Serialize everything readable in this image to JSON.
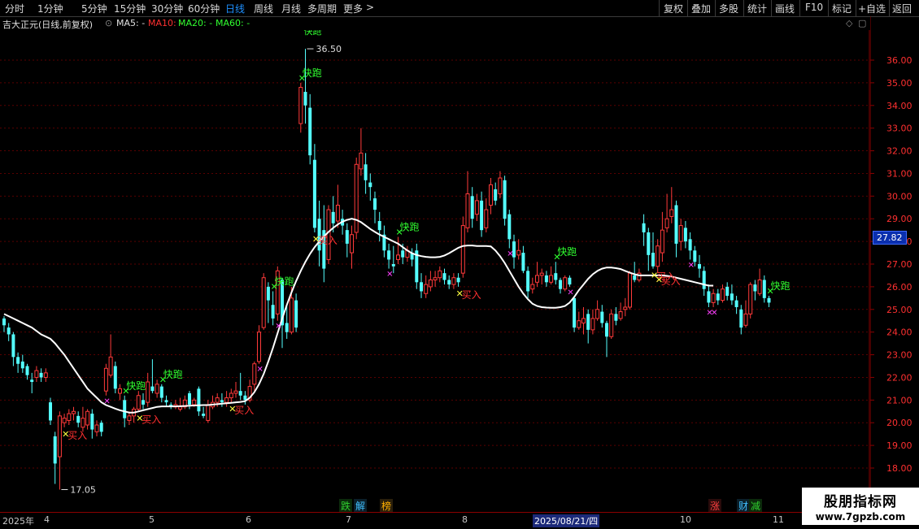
{
  "toolbar": {
    "periods": [
      "分时",
      "1分钟",
      "5分钟",
      "15分钟",
      "30分钟",
      "60分钟",
      "日线",
      "周线",
      "月线",
      "多周期",
      "更多"
    ],
    "more_arrow": ">",
    "active_period": "日线",
    "tools": [
      "复权",
      "叠加",
      "多股",
      "统计",
      "画线",
      "F10",
      "标记",
      "+自选",
      "返回"
    ]
  },
  "chart_title": {
    "name": "吉大正元(日线,前复权)",
    "ma5": "MA5: -",
    "ma10": "MA10: -",
    "ma20": "MA20: -",
    "ma60": "MA60: -",
    "colors": {
      "name": "#e0e0e0",
      "ma5": "#e0e0e0",
      "ma10": "#ff3030",
      "ma20": "#30ff30",
      "ma60": "#30ff30"
    }
  },
  "price_tag": "27.82",
  "annotations": {
    "high": "36.50",
    "low": "17.05",
    "high_mark": "快跑"
  },
  "events": [
    {
      "label": "跌",
      "color": "#30d030",
      "bg": "#0b2a0b"
    },
    {
      "label": "解",
      "color": "#40c0ff",
      "bg": "#0b1f2a"
    },
    {
      "label": "榜",
      "color": "#ffb000",
      "bg": "#2a1f0b"
    },
    {
      "label": "涨",
      "color": "#ff4040",
      "bg": "#2a0b0b"
    },
    {
      "label": "财",
      "color": "#40c0ff",
      "bg": "#0b1f2a"
    },
    {
      "label": "减",
      "color": "#30d030",
      "bg": "#0b2a0b"
    }
  ],
  "dates": [
    {
      "label": "2025年",
      "hl": false
    },
    {
      "label": "4",
      "hl": false
    },
    {
      "label": "5",
      "hl": false
    },
    {
      "label": "6",
      "hl": false
    },
    {
      "label": "7",
      "hl": false
    },
    {
      "label": "8",
      "hl": false
    },
    {
      "label": "2025/08/21/四",
      "hl": true
    },
    {
      "label": "10",
      "hl": false
    },
    {
      "label": "11",
      "hl": false
    }
  ],
  "watermark": {
    "line1": "股朋指标网",
    "line2": "www.7gpzb.com"
  },
  "chart_data": {
    "type": "candlestick",
    "title": "吉大正元(日线,前复权)",
    "ylim": [
      17.4,
      36.8
    ],
    "yticks": [
      18,
      19,
      20,
      21,
      22,
      23,
      24,
      25,
      26,
      27,
      28,
      29,
      30,
      31,
      32,
      33,
      34,
      35,
      36
    ],
    "ytick_labels": [
      "18.00",
      "19.00",
      "20.00",
      "21.00",
      "22.00",
      "23.00",
      "24.00",
      "25.00",
      "26.00",
      "27.00",
      "28.00",
      "29.00",
      "30.00",
      "31.00",
      "32.00",
      "33.00",
      "34.00",
      "35.00",
      "36.00"
    ],
    "grid": true,
    "up_color": "#ff3a3a",
    "down_color": "#54ffff",
    "ma_color": "#ffffff",
    "signal_colors": {
      "sell": "#30ff30",
      "buy": "#ffff40",
      "buy_text": "#ff3030",
      "x_mark": "#ff40ff"
    },
    "signal_labels": {
      "sell": "快跑",
      "buy": "买入"
    },
    "candles": [
      [
        24.6,
        24.3,
        24.7,
        24.0
      ],
      [
        24.2,
        23.9,
        24.4,
        23.6
      ],
      [
        23.9,
        22.9,
        24.0,
        22.5
      ],
      [
        22.9,
        22.6,
        23.1,
        22.2
      ],
      [
        22.7,
        22.4,
        23.0,
        22.2
      ],
      [
        22.5,
        22.1,
        22.6,
        21.9
      ],
      [
        21.9,
        21.8,
        22.2,
        21.3
      ],
      [
        22.0,
        22.3,
        22.5,
        21.8
      ],
      [
        22.2,
        22.0,
        22.4,
        21.8
      ],
      [
        22.0,
        22.2,
        22.4,
        21.8
      ],
      [
        20.9,
        20.1,
        21.1,
        19.9
      ],
      [
        19.4,
        18.2,
        19.6,
        17.3
      ],
      [
        18.5,
        20.3,
        20.5,
        17.05
      ],
      [
        20.0,
        20.2,
        20.4,
        19.8
      ],
      [
        20.1,
        20.4,
        20.6,
        19.9
      ],
      [
        20.4,
        20.5,
        20.7,
        20.1
      ],
      [
        20.3,
        20.0,
        20.5,
        19.8
      ],
      [
        19.8,
        20.2,
        20.7,
        19.6
      ],
      [
        19.9,
        20.5,
        20.6,
        19.7
      ],
      [
        20.4,
        19.7,
        20.6,
        19.3
      ],
      [
        19.6,
        19.9,
        20.1,
        19.4
      ],
      [
        20.0,
        19.6,
        20.1,
        19.4
      ],
      [
        21.4,
        22.4,
        22.6,
        21.2
      ],
      [
        22.1,
        22.9,
        23.9,
        22.0
      ],
      [
        22.5,
        21.5,
        22.7,
        21.3
      ],
      [
        21.3,
        21.5,
        21.7,
        21.0
      ],
      [
        21.0,
        20.2,
        21.2,
        19.8
      ],
      [
        20.1,
        20.3,
        20.5,
        19.9
      ],
      [
        20.3,
        20.6,
        20.7,
        20.0
      ],
      [
        20.6,
        21.2,
        21.4,
        20.5
      ],
      [
        21.0,
        20.8,
        21.3,
        20.6
      ],
      [
        20.9,
        21.8,
        22.2,
        20.7
      ],
      [
        21.6,
        21.4,
        22.8,
        21.3
      ],
      [
        21.3,
        21.7,
        21.9,
        21.1
      ],
      [
        21.6,
        21.1,
        21.7,
        20.9
      ],
      [
        21.0,
        20.9,
        21.2,
        20.7
      ],
      [
        20.8,
        20.7,
        20.9,
        20.6
      ],
      [
        20.7,
        20.8,
        21.0,
        20.6
      ],
      [
        20.6,
        20.7,
        21.1,
        20.5
      ],
      [
        20.7,
        21.0,
        21.2,
        20.6
      ],
      [
        21.3,
        20.8,
        21.4,
        20.6
      ],
      [
        20.8,
        21.0,
        21.1,
        20.7
      ],
      [
        21.5,
        20.5,
        21.6,
        20.3
      ],
      [
        20.4,
        20.3,
        20.7,
        20.2
      ],
      [
        20.1,
        20.8,
        21.0,
        20.0
      ],
      [
        20.7,
        20.9,
        21.2,
        20.6
      ],
      [
        20.9,
        21.1,
        21.3,
        20.7
      ],
      [
        21.0,
        20.9,
        21.3,
        20.7
      ],
      [
        20.9,
        21.1,
        21.4,
        20.7
      ],
      [
        21.1,
        21.3,
        21.5,
        20.9
      ],
      [
        21.3,
        21.4,
        21.8,
        21.1
      ],
      [
        21.4,
        21.2,
        22.2,
        21.0
      ],
      [
        21.2,
        21.0,
        21.4,
        20.8
      ],
      [
        21.0,
        21.6,
        21.9,
        20.9
      ],
      [
        21.7,
        22.6,
        22.7,
        21.4
      ],
      [
        22.7,
        24.0,
        24.3,
        22.6
      ],
      [
        24.2,
        26.4,
        26.6,
        24.1
      ],
      [
        26.0,
        25.4,
        26.2,
        24.4
      ],
      [
        25.2,
        24.6,
        25.8,
        24.3
      ],
      [
        24.8,
        26.7,
        26.9,
        24.5
      ],
      [
        26.3,
        24.3,
        26.4,
        23.3
      ],
      [
        24.4,
        24.0,
        25.2,
        23.7
      ],
      [
        24.0,
        25.5,
        26.0,
        23.9
      ],
      [
        25.4,
        24.2,
        25.7,
        24.0
      ],
      [
        33.2,
        34.8,
        35.0,
        32.8
      ],
      [
        34.6,
        34.0,
        36.5,
        33.2
      ],
      [
        33.9,
        31.8,
        34.5,
        31.4
      ],
      [
        31.6,
        28.6,
        32.3,
        28.4
      ],
      [
        29.0,
        27.6,
        29.8,
        26.9
      ],
      [
        28.5,
        26.8,
        29.6,
        26.2
      ],
      [
        27.2,
        29.4,
        29.6,
        27.0
      ],
      [
        29.3,
        28.8,
        30.0,
        28.4
      ],
      [
        28.9,
        29.6,
        30.5,
        28.6
      ],
      [
        29.0,
        28.7,
        29.4,
        28.3
      ],
      [
        28.5,
        27.9,
        28.8,
        27.3
      ],
      [
        27.5,
        28.3,
        28.7,
        26.8
      ],
      [
        28.4,
        31.4,
        31.7,
        28.1
      ],
      [
        31.2,
        31.9,
        33.0,
        30.9
      ],
      [
        31.4,
        30.7,
        31.9,
        30.1
      ],
      [
        30.6,
        30.4,
        31.0,
        29.8
      ],
      [
        29.9,
        29.4,
        30.2,
        28.8
      ],
      [
        28.9,
        28.5,
        29.3,
        28.0
      ],
      [
        28.3,
        27.6,
        28.7,
        27.3
      ],
      [
        27.6,
        27.2,
        27.9,
        26.8
      ],
      [
        27.0,
        26.9,
        27.8,
        26.6
      ],
      [
        27.2,
        27.4,
        28.2,
        27.0
      ],
      [
        27.6,
        27.3,
        27.9,
        27.0
      ],
      [
        27.3,
        27.6,
        27.8,
        27.1
      ],
      [
        27.5,
        27.2,
        27.7,
        26.9
      ],
      [
        27.6,
        26.2,
        27.9,
        25.9
      ],
      [
        26.2,
        25.8,
        26.6,
        25.5
      ],
      [
        25.7,
        26.1,
        26.5,
        25.5
      ],
      [
        26.0,
        26.3,
        26.7,
        25.8
      ],
      [
        26.3,
        26.4,
        26.7,
        26.0
      ],
      [
        26.4,
        26.7,
        26.9,
        26.2
      ],
      [
        26.6,
        26.3,
        26.8,
        26.1
      ],
      [
        26.3,
        26.1,
        26.5,
        25.9
      ],
      [
        26.1,
        26.4,
        26.6,
        25.9
      ],
      [
        26.4,
        26.2,
        26.6,
        26.0
      ],
      [
        26.6,
        28.7,
        29.1,
        26.4
      ],
      [
        28.6,
        30.1,
        31.1,
        28.4
      ],
      [
        30.0,
        29.0,
        30.4,
        28.6
      ],
      [
        29.2,
        29.8,
        30.1,
        28.9
      ],
      [
        29.8,
        28.5,
        30.2,
        28.2
      ],
      [
        28.6,
        29.4,
        29.9,
        28.4
      ],
      [
        29.6,
        30.5,
        30.8,
        29.2
      ],
      [
        30.3,
        29.8,
        30.6,
        29.6
      ],
      [
        30.1,
        30.8,
        31.1,
        29.9
      ],
      [
        30.7,
        29.0,
        30.9,
        28.7
      ],
      [
        29.2,
        28.1,
        29.4,
        27.7
      ],
      [
        28.0,
        27.3,
        28.3,
        26.8
      ],
      [
        27.4,
        27.6,
        28.1,
        27.2
      ],
      [
        27.5,
        26.7,
        27.8,
        26.6
      ],
      [
        26.7,
        25.8,
        26.9,
        25.5
      ],
      [
        25.9,
        26.1,
        26.4,
        25.7
      ],
      [
        26.2,
        26.5,
        27.1,
        26.0
      ],
      [
        26.5,
        26.6,
        26.8,
        26.1
      ],
      [
        26.5,
        26.2,
        26.7,
        26.0
      ],
      [
        26.2,
        26.5,
        26.9,
        26.1
      ],
      [
        26.6,
        26.3,
        27.1,
        26.1
      ],
      [
        26.3,
        25.9,
        26.4,
        25.7
      ],
      [
        25.9,
        26.4,
        26.5,
        25.8
      ],
      [
        26.4,
        26.1,
        26.5,
        26.0
      ],
      [
        25.5,
        24.2,
        25.6,
        24.0
      ],
      [
        24.2,
        24.5,
        24.9,
        24.1
      ],
      [
        24.4,
        24.6,
        25.1,
        23.9
      ],
      [
        24.8,
        24.1,
        25.0,
        23.5
      ],
      [
        24.1,
        24.6,
        25.0,
        23.9
      ],
      [
        24.6,
        25.0,
        25.4,
        24.5
      ],
      [
        24.9,
        24.4,
        25.2,
        24.2
      ],
      [
        24.4,
        23.8,
        24.5,
        22.9
      ],
      [
        23.8,
        24.8,
        25.0,
        23.7
      ],
      [
        24.8,
        24.5,
        25.1,
        24.3
      ],
      [
        24.6,
        24.9,
        25.3,
        24.5
      ],
      [
        25.0,
        25.1,
        25.5,
        24.7
      ],
      [
        25.1,
        26.6,
        26.7,
        25.0
      ],
      [
        26.5,
        26.3,
        27.1,
        26.2
      ],
      [
        26.3,
        26.6,
        26.8,
        26.2
      ],
      [
        28.8,
        28.4,
        29.2,
        27.8
      ],
      [
        28.4,
        27.4,
        28.6,
        26.7
      ],
      [
        27.5,
        26.9,
        28.4,
        26.8
      ],
      [
        26.9,
        27.8,
        28.1,
        26.6
      ],
      [
        27.5,
        28.5,
        29.3,
        27.1
      ],
      [
        28.6,
        29.0,
        30.1,
        28.4
      ],
      [
        29.1,
        29.4,
        30.4,
        28.8
      ],
      [
        29.6,
        27.9,
        29.8,
        27.3
      ],
      [
        28.0,
        28.7,
        29.0,
        27.6
      ],
      [
        28.6,
        28.0,
        28.9,
        27.7
      ],
      [
        28.1,
        27.6,
        28.4,
        27.2
      ],
      [
        27.6,
        27.1,
        27.8,
        26.9
      ],
      [
        27.0,
        26.8,
        27.4,
        26.4
      ],
      [
        26.7,
        25.9,
        26.9,
        25.6
      ],
      [
        25.8,
        25.3,
        26.1,
        25.1
      ],
      [
        25.3,
        25.7,
        25.9,
        25.1
      ],
      [
        25.7,
        25.4,
        25.9,
        25.2
      ],
      [
        25.4,
        25.9,
        26.1,
        25.3
      ],
      [
        26.0,
        25.6,
        26.2,
        25.4
      ],
      [
        25.7,
        25.4,
        26.1,
        25.2
      ],
      [
        25.4,
        25.1,
        25.6,
        24.8
      ],
      [
        25.0,
        24.2,
        25.2,
        23.9
      ],
      [
        24.3,
        24.8,
        25.4,
        24.2
      ],
      [
        24.8,
        26.1,
        26.2,
        24.6
      ],
      [
        26.1,
        25.8,
        26.3,
        25.4
      ],
      [
        25.7,
        26.3,
        26.8,
        25.6
      ],
      [
        26.3,
        25.5,
        26.5,
        25.3
      ],
      [
        25.5,
        25.3,
        25.6,
        25.1
      ]
    ],
    "ma": [
      24.8,
      24.7,
      24.6,
      24.5,
      24.4,
      24.3,
      24.2,
      24.05,
      23.9,
      23.8,
      23.7,
      23.5,
      23.25,
      23.0,
      22.7,
      22.4,
      22.1,
      21.8,
      21.5,
      21.3,
      21.1,
      20.9,
      20.78,
      20.7,
      20.62,
      20.55,
      20.5,
      20.45,
      20.45,
      20.5,
      20.55,
      20.6,
      20.65,
      20.7,
      20.72,
      20.72,
      20.72,
      20.72,
      20.73,
      20.74,
      20.75,
      20.76,
      20.77,
      20.78,
      20.78,
      20.8,
      20.82,
      20.84,
      20.86,
      20.88,
      20.9,
      20.92,
      20.95,
      21.1,
      21.35,
      21.7,
      22.15,
      22.7,
      23.3,
      23.95,
      24.6,
      25.2,
      25.75,
      26.25,
      26.7,
      27.1,
      27.45,
      27.75,
      28.0,
      28.22,
      28.42,
      28.6,
      28.75,
      28.87,
      28.95,
      29.0,
      28.95,
      28.85,
      28.7,
      28.55,
      28.42,
      28.3,
      28.2,
      28.1,
      28.0,
      27.9,
      27.75,
      27.6,
      27.48,
      27.4,
      27.35,
      27.32,
      27.3,
      27.3,
      27.32,
      27.38,
      27.48,
      27.6,
      27.72,
      27.8,
      27.82,
      27.82,
      27.8,
      27.8,
      27.8,
      27.78,
      27.6,
      27.35,
      27.05,
      26.7,
      26.35,
      26.0,
      25.7,
      25.45,
      25.25,
      25.15,
      25.1,
      25.08,
      25.07,
      25.07,
      25.1,
      25.15,
      25.3,
      25.55,
      25.85,
      26.1,
      26.35,
      26.55,
      26.7,
      26.8,
      26.85,
      26.85,
      26.82,
      26.78,
      26.7,
      26.62,
      26.55,
      26.5,
      26.5,
      26.5,
      26.5,
      26.5,
      26.5,
      26.48,
      26.45,
      26.4,
      26.35,
      26.3,
      26.25,
      26.2,
      26.15,
      26.1,
      26.05,
      26.05
    ]
  }
}
